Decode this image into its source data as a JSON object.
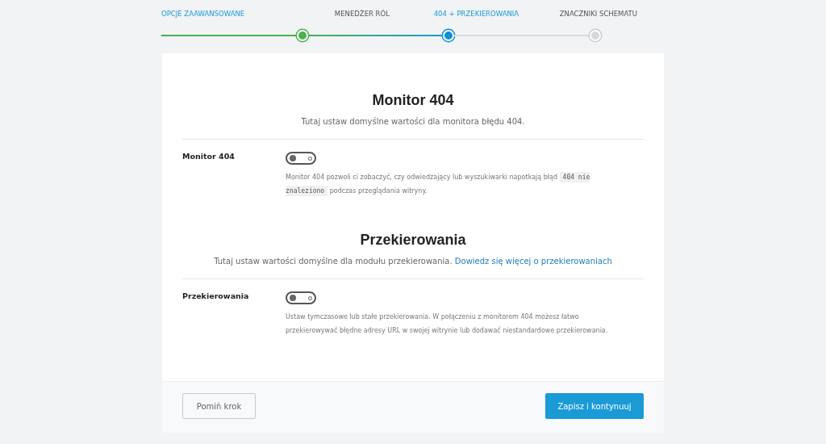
{
  "steps": [
    {
      "label": "OPCJE ZAAWANSOWANE",
      "completed": true,
      "selected": false,
      "highlighted": true
    },
    {
      "label": "MENEDŻER RÓL",
      "completed": true,
      "selected": false,
      "highlighted": false
    },
    {
      "label": "404 + PRZEKIEROWANIA",
      "completed": false,
      "selected": true,
      "highlighted": true
    },
    {
      "label": "ZNACZNIKI SCHEMATU",
      "completed": false,
      "selected": false,
      "highlighted": false
    }
  ],
  "sections": [
    {
      "title": "Monitor 404",
      "subtitle": "Tutaj ustaw domyślne wartości dla monitora błędu 404.",
      "settings": [
        {
          "label": "Monitor 404",
          "on": false,
          "description": [
            {
              "kind": "text",
              "text": "Monitor 404 pozwoli ci zobaczyć, czy odwiedzający lub wyszukiwarki napotkają błąd "
            },
            {
              "kind": "code",
              "text": "404 nie znaleziono"
            },
            {
              "kind": "text",
              "text": " podczas przeglądania witryny."
            }
          ]
        }
      ]
    },
    {
      "title": "Przekierowania",
      "subtitle": "Tutaj ustaw wartości domyślne dla modułu przekierowania.",
      "link": "Dowiedz się więcej o przekierowaniach",
      "settings": [
        {
          "label": "Przekierowania",
          "on": false,
          "description": [
            {
              "kind": "text",
              "text": "Ustaw tymczasowe lub stałe przekierowania. W połączeniu z monitorem 404 możesz łatwo przekierowywać błędne adresy URL w swojej witrynie lub dodawać niestandardowe przekierowania."
            }
          ]
        }
      ]
    }
  ],
  "footer": {
    "skip_button": "Pomiń krok",
    "save_button": "Zapisz i kontynuuj"
  }
}
